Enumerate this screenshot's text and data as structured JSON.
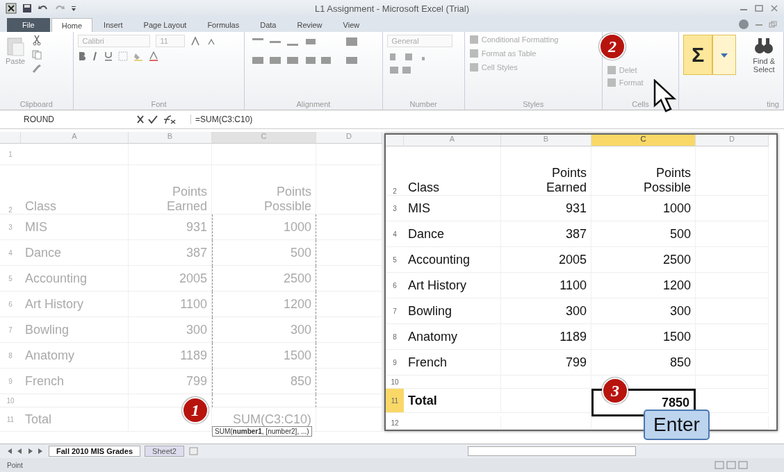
{
  "window": {
    "title": "L1 Assignment - Microsoft Excel (Trial)"
  },
  "tabs": [
    {
      "label": "File",
      "selected": false,
      "kind": "file"
    },
    {
      "label": "Home",
      "selected": true,
      "kind": "tab"
    },
    {
      "label": "Insert",
      "selected": false,
      "kind": "tab"
    },
    {
      "label": "Page Layout",
      "selected": false,
      "kind": "tab"
    },
    {
      "label": "Formulas",
      "selected": false,
      "kind": "tab"
    },
    {
      "label": "Data",
      "selected": false,
      "kind": "tab"
    },
    {
      "label": "Review",
      "selected": false,
      "kind": "tab"
    },
    {
      "label": "View",
      "selected": false,
      "kind": "tab"
    }
  ],
  "ribbon": {
    "clipboard": {
      "label": "Clipboard",
      "paste": "Paste"
    },
    "font": {
      "label": "Font",
      "name": "Calibri",
      "size": "11"
    },
    "alignment": {
      "label": "Alignment"
    },
    "number": {
      "label": "Number",
      "format": "General"
    },
    "styles": {
      "label": "Styles",
      "items": [
        "Conditional Formatting",
        "Format as Table",
        "Cell Styles"
      ]
    },
    "cells": {
      "label": "Cells",
      "items": [
        "Delet",
        "Format"
      ]
    },
    "editing": {
      "label": "ting",
      "autosum": "Σ",
      "find": "Find &\nSelect"
    }
  },
  "formula_bar": {
    "name_box": "ROUND",
    "formula": "=SUM(C3:C10)"
  },
  "sheet": {
    "columns": [
      {
        "label": "A",
        "selected": false
      },
      {
        "label": "B",
        "selected": false
      },
      {
        "label": "C",
        "selected": true
      },
      {
        "label": "D",
        "selected": false
      }
    ],
    "rows": [
      {
        "num": "1",
        "cells": [
          "",
          "",
          ""
        ],
        "marquee": false
      },
      {
        "num": "2",
        "cells": [
          "Class",
          "Points\nEarned",
          "Points\nPossible"
        ],
        "marquee": false
      },
      {
        "num": "3",
        "cells": [
          "MIS",
          "931",
          "1000"
        ],
        "marquee": true
      },
      {
        "num": "4",
        "cells": [
          "Dance",
          "387",
          "500"
        ],
        "marquee": true
      },
      {
        "num": "5",
        "cells": [
          "Accounting",
          "2005",
          "2500"
        ],
        "marquee": true
      },
      {
        "num": "6",
        "cells": [
          "Art History",
          "1100",
          "1200"
        ],
        "marquee": true
      },
      {
        "num": "7",
        "cells": [
          "Bowling",
          "300",
          "300"
        ],
        "marquee": true
      },
      {
        "num": "8",
        "cells": [
          "Anatomy",
          "1189",
          "1500"
        ],
        "marquee": true
      },
      {
        "num": "9",
        "cells": [
          "French",
          "799",
          "850"
        ],
        "marquee": true
      },
      {
        "num": "10",
        "cells": [
          "",
          "",
          ""
        ],
        "marquee": true
      },
      {
        "num": "11",
        "cells": [
          "Total",
          "",
          "SUM(C3:C10)"
        ],
        "marquee": false
      }
    ]
  },
  "zoom_view": {
    "columns": [
      {
        "label": "A",
        "selected": false
      },
      {
        "label": "B",
        "selected": false
      },
      {
        "label": "C",
        "selected": true
      },
      {
        "label": "D",
        "selected": false
      }
    ],
    "rows": [
      {
        "num": "2",
        "cells": [
          "Class",
          "Points\nEarned",
          "Points\nPossible"
        ],
        "selected": false
      },
      {
        "num": "3",
        "cells": [
          "MIS",
          "931",
          "1000"
        ],
        "selected": false
      },
      {
        "num": "4",
        "cells": [
          "Dance",
          "387",
          "500"
        ],
        "selected": false
      },
      {
        "num": "5",
        "cells": [
          "Accounting",
          "2005",
          "2500"
        ],
        "selected": false
      },
      {
        "num": "6",
        "cells": [
          "Art History",
          "1100",
          "1200"
        ],
        "selected": false
      },
      {
        "num": "7",
        "cells": [
          "Bowling",
          "300",
          "300"
        ],
        "selected": false
      },
      {
        "num": "8",
        "cells": [
          "Anatomy",
          "1189",
          "1500"
        ],
        "selected": false
      },
      {
        "num": "9",
        "cells": [
          "French",
          "799",
          "850"
        ],
        "selected": false
      },
      {
        "num": "10",
        "cells": [
          "",
          "",
          ""
        ],
        "selected": false
      },
      {
        "num": "11",
        "cells": [
          "Total",
          "",
          "7850"
        ],
        "selected": true
      },
      {
        "num": "12",
        "cells": [
          "",
          "",
          ""
        ],
        "selected": false
      }
    ]
  },
  "steps": [
    "1",
    "2",
    "3"
  ],
  "key_label": "Enter",
  "tooltip": "SUM(**number1**, [number2], ...)",
  "sheet_tabs": [
    {
      "label": "Fall 2010 MIS Grades",
      "selected": true
    },
    {
      "label": "Sheet2",
      "selected": false
    }
  ],
  "status_bar": {
    "mode": "Point"
  }
}
